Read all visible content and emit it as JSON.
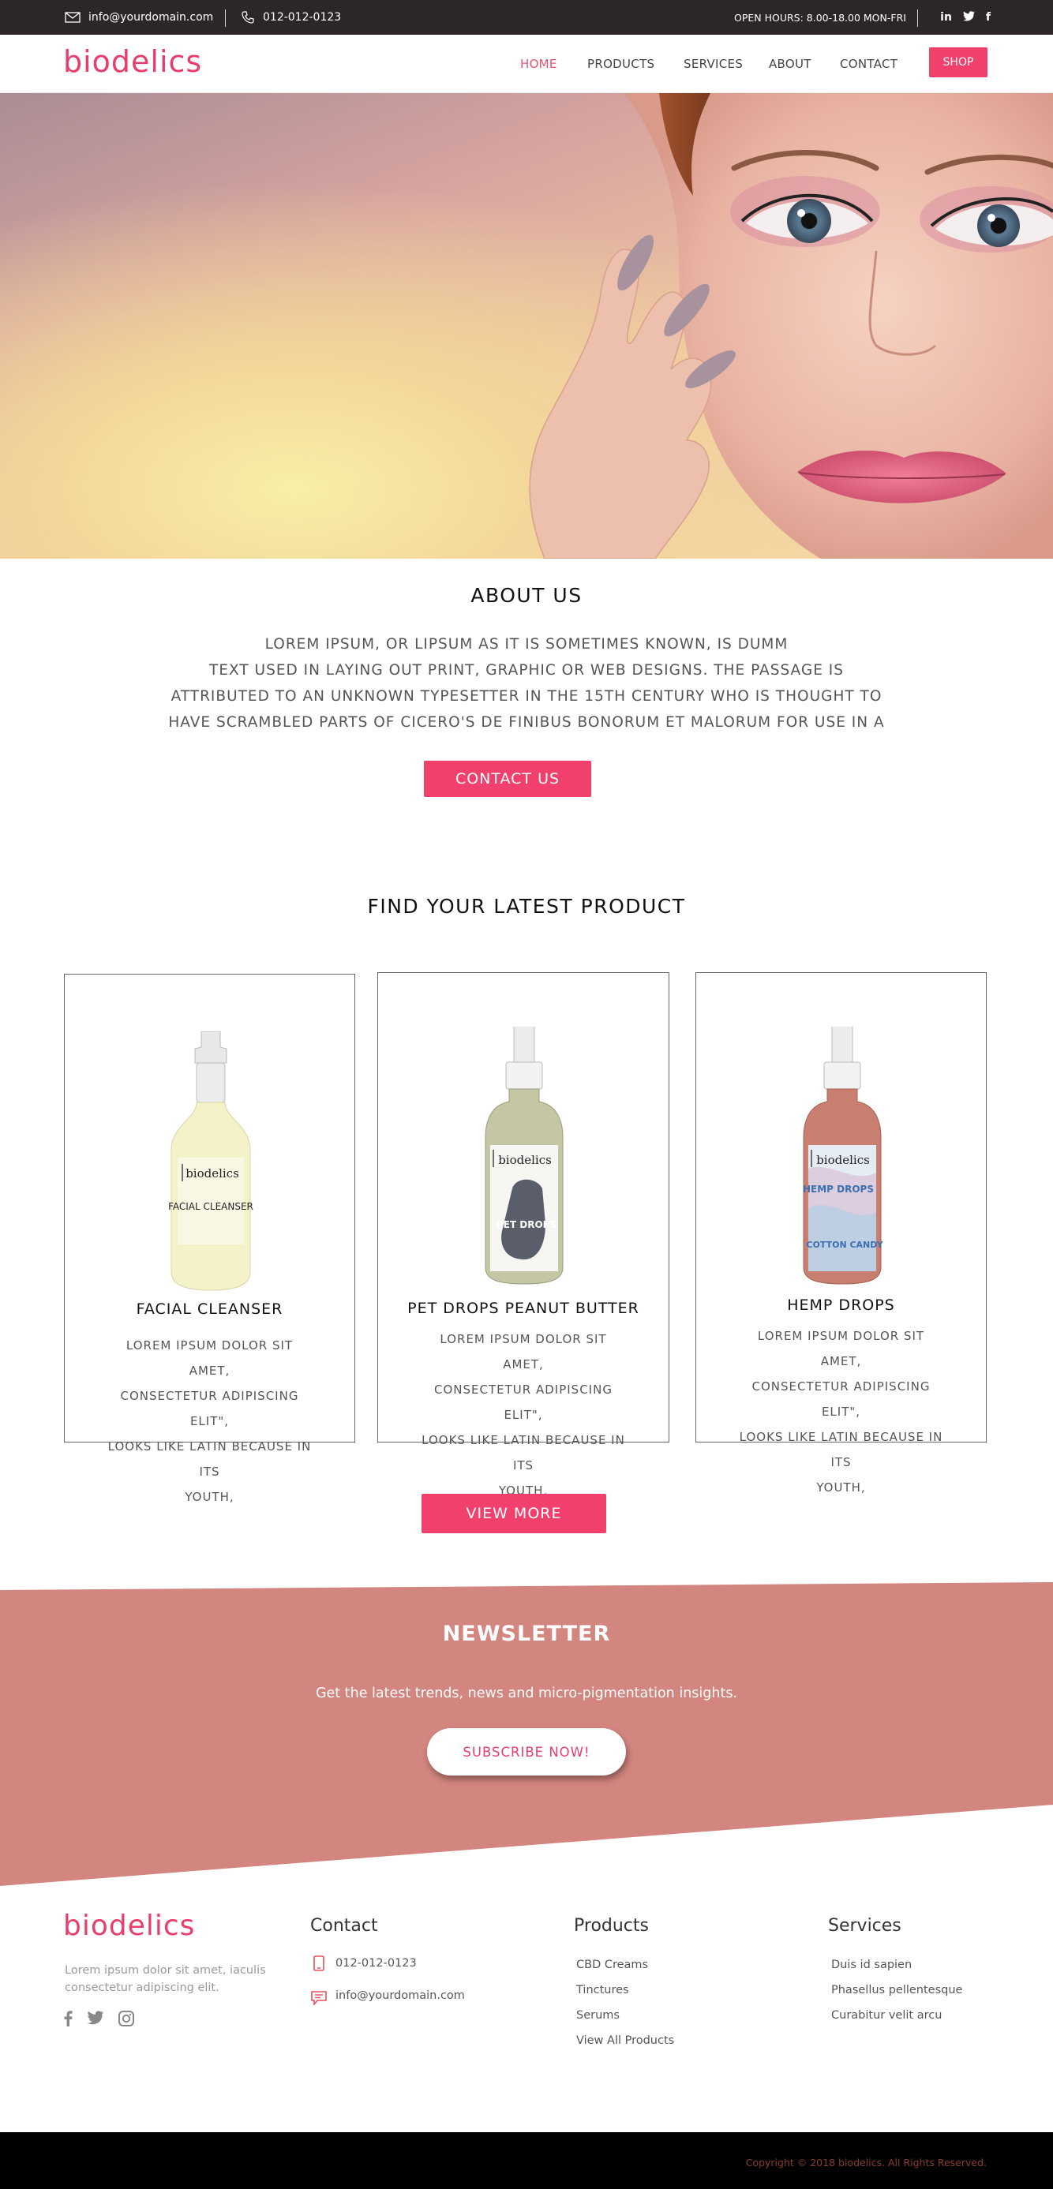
{
  "topbar": {
    "email": "info@yourdomain.com",
    "phone": "012-012-0123",
    "hours": "OPEN HOURS: 8.00-18.00 MON-FRI",
    "social": [
      "in",
      "t",
      "f"
    ]
  },
  "header": {
    "logo": "biodelics",
    "nav": [
      "HOME",
      "PRODUCTS",
      "SERVICES",
      "ABOUT",
      "CONTACT"
    ],
    "shop": "SHOP"
  },
  "about": {
    "title": "ABOUT US",
    "lines": [
      "LOREM IPSUM, OR LIPSUM AS IT IS SOMETIMES KNOWN, IS DUMM",
      "TEXT USED IN LAYING OUT PRINT, GRAPHIC OR WEB DESIGNS. THE PASSAGE IS",
      "ATTRIBUTED TO AN UNKNOWN TYPESETTER IN THE 15TH CENTURY WHO IS THOUGHT TO",
      "HAVE SCRAMBLED PARTS OF CICERO'S DE FINIBUS BONORUM ET MALORUM FOR USE IN A"
    ],
    "button": "CONTACT US"
  },
  "products": {
    "title": "FIND YOUR LATEST PRODUCT",
    "items": [
      {
        "name": "FACIAL CLEANSER",
        "label_brand": "biodelics",
        "label_text": "FACIAL CLEANSER",
        "desc": [
          "LOREM IPSUM DOLOR SIT AMET,",
          "CONSECTETUR ADIPISCING ELIT\",",
          "LOOKS LIKE LATIN BECAUSE IN ITS",
          "YOUTH,"
        ]
      },
      {
        "name": "PET DROPS PEANUT BUTTER",
        "label_brand": "biodelics",
        "label_text": "PET DROPS",
        "desc": [
          "LOREM IPSUM DOLOR SIT AMET,",
          "CONSECTETUR ADIPISCING ELIT\",",
          "LOOKS LIKE LATIN BECAUSE IN ITS",
          "YOUTH,"
        ]
      },
      {
        "name": "HEMP DROPS",
        "label_brand": "biodelics",
        "label_text": "HEMP DROPS",
        "label_text2": "COTTON CANDY",
        "desc": [
          "LOREM IPSUM DOLOR SIT AMET,",
          "CONSECTETUR ADIPISCING ELIT\",",
          "LOOKS LIKE LATIN BECAUSE IN ITS",
          "YOUTH,"
        ]
      }
    ],
    "view_more": "VIEW MORE"
  },
  "newsletter": {
    "title": "NEWSLETTER",
    "subtitle": "Get the latest trends, news and micro-pigmentation insights.",
    "button": "SUBSCRIBE NOW!"
  },
  "footer": {
    "logo": "biodelics",
    "tagline": [
      "Lorem ipsum dolor sit amet, iaculis",
      "consectetur adipiscing elit."
    ],
    "contact": {
      "title": "Contact",
      "phone": "012-012-0123",
      "email": "info@yourdomain.com"
    },
    "products": {
      "title": "Products",
      "items": [
        "CBD Creams",
        "Tinctures",
        "Serums",
        "View All Products"
      ]
    },
    "services": {
      "title": "Services",
      "items": [
        "Duis id sapien",
        "Phasellus pellentesque",
        "Curabitur velit arcu"
      ]
    },
    "copyright": "Copyright © 2018 biodelics. All Rights Reserved."
  },
  "colors": {
    "accent": "#f2406c",
    "newsletter_bg": "#d3857f",
    "topbar_bg": "#2d2628"
  }
}
